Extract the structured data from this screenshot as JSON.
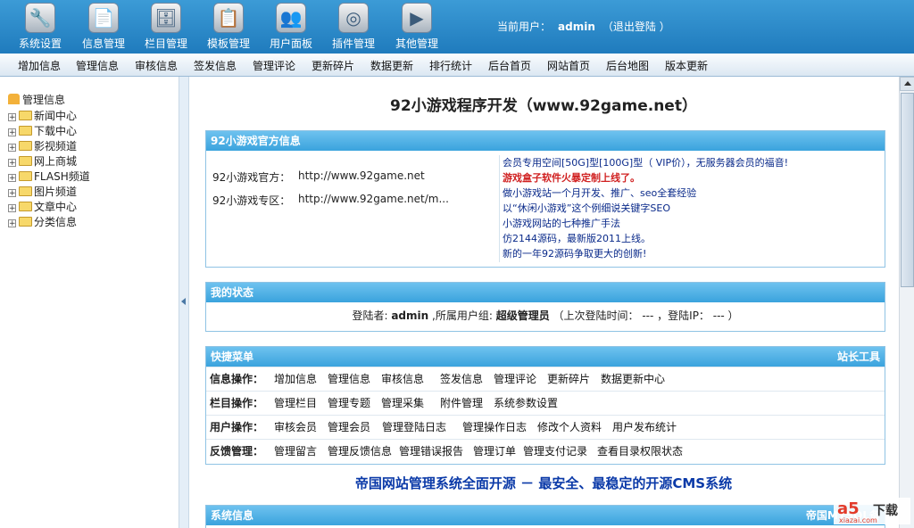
{
  "toolbar": [
    {
      "label": "系统设置",
      "icon": "wrench-icon",
      "glyph": "🔧"
    },
    {
      "label": "信息管理",
      "icon": "documents-icon",
      "glyph": "📄"
    },
    {
      "label": "栏目管理",
      "icon": "cabinet-icon",
      "glyph": "🗄"
    },
    {
      "label": "模板管理",
      "icon": "template-icon",
      "glyph": "📋"
    },
    {
      "label": "用户面板",
      "icon": "users-icon",
      "glyph": "👥"
    },
    {
      "label": "插件管理",
      "icon": "lifebuoy-icon",
      "glyph": "◎"
    },
    {
      "label": "其他管理",
      "icon": "play-icon",
      "glyph": "▶"
    }
  ],
  "user": {
    "prefix": "当前用户：",
    "name": "admin",
    "logout": "（退出登陆 ）"
  },
  "menu": [
    "增加信息",
    "管理信息",
    "审核信息",
    "签发信息",
    "管理评论",
    "更新碎片",
    "数据更新",
    "排行统计",
    "后台首页",
    "网站首页",
    "后台地图",
    "版本更新"
  ],
  "tree": {
    "root": "管理信息",
    "nodes": [
      "新闻中心",
      "下载中心",
      "影视频道",
      "网上商城",
      "FLASH频道",
      "图片频道",
      "文章中心",
      "分类信息"
    ]
  },
  "main": {
    "title": "92小游戏程序开发（www.92game.net）",
    "official": {
      "header": "92小游戏官方信息",
      "site_label": "92小游戏官方：",
      "site_url": "http://www.92game.net",
      "zone_label": "92小游戏专区：",
      "zone_url": "http://www.92game.net/m...",
      "news": [
        "会员专用空间[50G]型[100G]型（ VIP价），无服务器会员的福音!",
        "游戏盒子软件火暴定制上线了。",
        "做小游戏站一个月开发、推广、seo全套经验",
        "以“休闲小游戏”这个例细说关键字SEO",
        "小游戏网站的七种推广手法",
        "仿2144源码，最新版2011上线。",
        "新的一年92源码争取更大的创新!"
      ]
    },
    "status": {
      "header": "我的状态",
      "login_label": "登陆者:",
      "login_name": "admin",
      "group_label": ",所属用户组:",
      "group_name": "超级管理员",
      "last": "（上次登陆时间： --- ，登陆IP： --- ）"
    },
    "quick": {
      "header": "快捷菜单",
      "right": "站长工具",
      "rows": [
        {
          "label": "信息操作：",
          "items": [
            "增加信息",
            "管理信息",
            "审核信息",
            "签发信息",
            "管理评论",
            "更新碎片",
            "数据更新中心"
          ]
        },
        {
          "label": "栏目操作：",
          "items": [
            "管理栏目",
            "管理专题",
            "管理采集",
            "附件管理",
            "系统参数设置"
          ]
        },
        {
          "label": "用户操作：",
          "items": [
            "审核会员",
            "管理会员",
            "管理登陆日志",
            "管理操作日志",
            "修改个人资料",
            "用户发布统计"
          ]
        },
        {
          "label": "反馈管理：",
          "items": [
            "管理留言",
            "管理反馈信息",
            "管理错误报告",
            "管理订单",
            "管理支付记录",
            "查看目录权限状态"
          ]
        }
      ]
    },
    "slogan": "帝国网站管理系统全面开源 － 最安全、最稳定的开源CMS系统",
    "sysinfo": {
      "header": "系统信息",
      "right": "帝国MYSQL备"
    }
  },
  "watermark": {
    "logo": "a5",
    "text": "下载",
    "url": "xiazai.com"
  }
}
